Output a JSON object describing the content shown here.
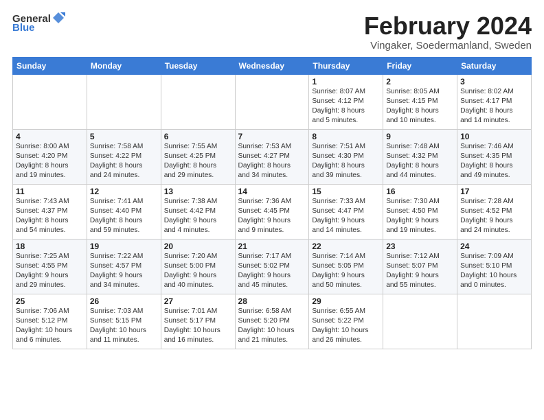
{
  "logo": {
    "general": "General",
    "blue": "Blue"
  },
  "title": "February 2024",
  "location": "Vingaker, Soedermanland, Sweden",
  "headers": [
    "Sunday",
    "Monday",
    "Tuesday",
    "Wednesday",
    "Thursday",
    "Friday",
    "Saturday"
  ],
  "weeks": [
    [
      {
        "day": "",
        "detail": ""
      },
      {
        "day": "",
        "detail": ""
      },
      {
        "day": "",
        "detail": ""
      },
      {
        "day": "",
        "detail": ""
      },
      {
        "day": "1",
        "detail": "Sunrise: 8:07 AM\nSunset: 4:12 PM\nDaylight: 8 hours\nand 5 minutes."
      },
      {
        "day": "2",
        "detail": "Sunrise: 8:05 AM\nSunset: 4:15 PM\nDaylight: 8 hours\nand 10 minutes."
      },
      {
        "day": "3",
        "detail": "Sunrise: 8:02 AM\nSunset: 4:17 PM\nDaylight: 8 hours\nand 14 minutes."
      }
    ],
    [
      {
        "day": "4",
        "detail": "Sunrise: 8:00 AM\nSunset: 4:20 PM\nDaylight: 8 hours\nand 19 minutes."
      },
      {
        "day": "5",
        "detail": "Sunrise: 7:58 AM\nSunset: 4:22 PM\nDaylight: 8 hours\nand 24 minutes."
      },
      {
        "day": "6",
        "detail": "Sunrise: 7:55 AM\nSunset: 4:25 PM\nDaylight: 8 hours\nand 29 minutes."
      },
      {
        "day": "7",
        "detail": "Sunrise: 7:53 AM\nSunset: 4:27 PM\nDaylight: 8 hours\nand 34 minutes."
      },
      {
        "day": "8",
        "detail": "Sunrise: 7:51 AM\nSunset: 4:30 PM\nDaylight: 8 hours\nand 39 minutes."
      },
      {
        "day": "9",
        "detail": "Sunrise: 7:48 AM\nSunset: 4:32 PM\nDaylight: 8 hours\nand 44 minutes."
      },
      {
        "day": "10",
        "detail": "Sunrise: 7:46 AM\nSunset: 4:35 PM\nDaylight: 8 hours\nand 49 minutes."
      }
    ],
    [
      {
        "day": "11",
        "detail": "Sunrise: 7:43 AM\nSunset: 4:37 PM\nDaylight: 8 hours\nand 54 minutes."
      },
      {
        "day": "12",
        "detail": "Sunrise: 7:41 AM\nSunset: 4:40 PM\nDaylight: 8 hours\nand 59 minutes."
      },
      {
        "day": "13",
        "detail": "Sunrise: 7:38 AM\nSunset: 4:42 PM\nDaylight: 9 hours\nand 4 minutes."
      },
      {
        "day": "14",
        "detail": "Sunrise: 7:36 AM\nSunset: 4:45 PM\nDaylight: 9 hours\nand 9 minutes."
      },
      {
        "day": "15",
        "detail": "Sunrise: 7:33 AM\nSunset: 4:47 PM\nDaylight: 9 hours\nand 14 minutes."
      },
      {
        "day": "16",
        "detail": "Sunrise: 7:30 AM\nSunset: 4:50 PM\nDaylight: 9 hours\nand 19 minutes."
      },
      {
        "day": "17",
        "detail": "Sunrise: 7:28 AM\nSunset: 4:52 PM\nDaylight: 9 hours\nand 24 minutes."
      }
    ],
    [
      {
        "day": "18",
        "detail": "Sunrise: 7:25 AM\nSunset: 4:55 PM\nDaylight: 9 hours\nand 29 minutes."
      },
      {
        "day": "19",
        "detail": "Sunrise: 7:22 AM\nSunset: 4:57 PM\nDaylight: 9 hours\nand 34 minutes."
      },
      {
        "day": "20",
        "detail": "Sunrise: 7:20 AM\nSunset: 5:00 PM\nDaylight: 9 hours\nand 40 minutes."
      },
      {
        "day": "21",
        "detail": "Sunrise: 7:17 AM\nSunset: 5:02 PM\nDaylight: 9 hours\nand 45 minutes."
      },
      {
        "day": "22",
        "detail": "Sunrise: 7:14 AM\nSunset: 5:05 PM\nDaylight: 9 hours\nand 50 minutes."
      },
      {
        "day": "23",
        "detail": "Sunrise: 7:12 AM\nSunset: 5:07 PM\nDaylight: 9 hours\nand 55 minutes."
      },
      {
        "day": "24",
        "detail": "Sunrise: 7:09 AM\nSunset: 5:10 PM\nDaylight: 10 hours\nand 0 minutes."
      }
    ],
    [
      {
        "day": "25",
        "detail": "Sunrise: 7:06 AM\nSunset: 5:12 PM\nDaylight: 10 hours\nand 6 minutes."
      },
      {
        "day": "26",
        "detail": "Sunrise: 7:03 AM\nSunset: 5:15 PM\nDaylight: 10 hours\nand 11 minutes."
      },
      {
        "day": "27",
        "detail": "Sunrise: 7:01 AM\nSunset: 5:17 PM\nDaylight: 10 hours\nand 16 minutes."
      },
      {
        "day": "28",
        "detail": "Sunrise: 6:58 AM\nSunset: 5:20 PM\nDaylight: 10 hours\nand 21 minutes."
      },
      {
        "day": "29",
        "detail": "Sunrise: 6:55 AM\nSunset: 5:22 PM\nDaylight: 10 hours\nand 26 minutes."
      },
      {
        "day": "",
        "detail": ""
      },
      {
        "day": "",
        "detail": ""
      }
    ]
  ]
}
